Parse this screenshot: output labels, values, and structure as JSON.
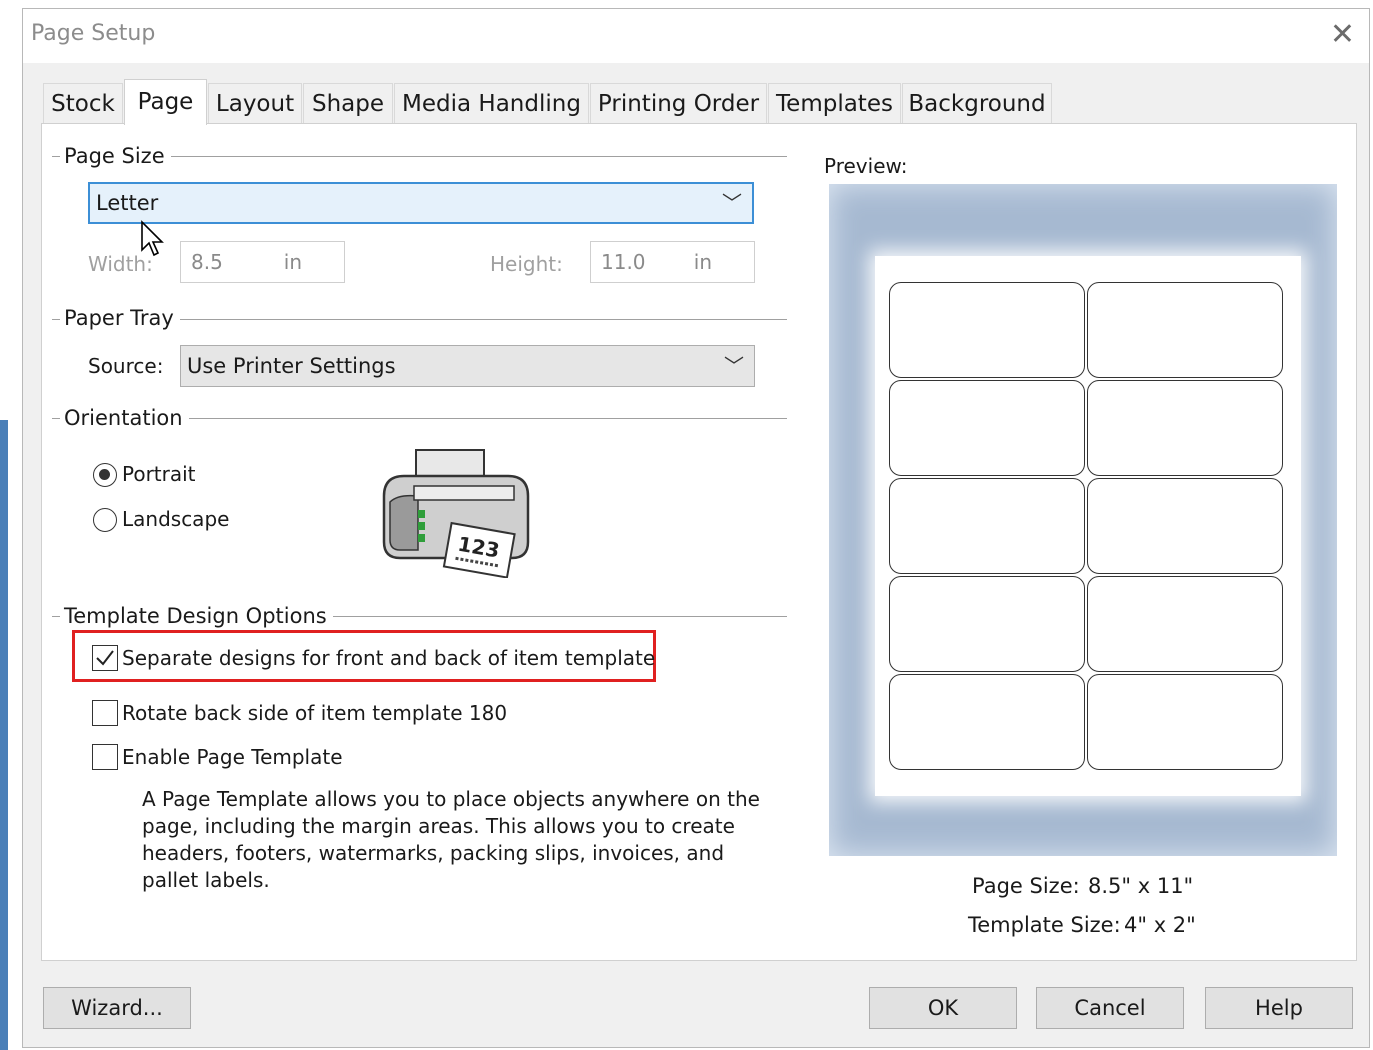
{
  "window": {
    "title": "Page Setup"
  },
  "tabs": [
    {
      "label": "Stock"
    },
    {
      "label": "Page"
    },
    {
      "label": "Layout"
    },
    {
      "label": "Shape"
    },
    {
      "label": "Media Handling"
    },
    {
      "label": "Printing Order"
    },
    {
      "label": "Templates"
    },
    {
      "label": "Background"
    }
  ],
  "active_tab": "Page",
  "page_size": {
    "group_label": "Page Size",
    "selected": "Letter",
    "width_label": "Width:",
    "width_value": "8.5",
    "width_unit": "in",
    "height_label": "Height:",
    "height_value": "11.0",
    "height_unit": "in"
  },
  "paper_tray": {
    "group_label": "Paper Tray",
    "source_label": "Source:",
    "source_value": "Use Printer Settings"
  },
  "orientation": {
    "group_label": "Orientation",
    "portrait_label": "Portrait",
    "landscape_label": "Landscape",
    "selected": "Portrait",
    "printer_page_text": "123"
  },
  "template_design": {
    "group_label": "Template Design Options",
    "separate_label": "Separate designs for front and back of item template",
    "separate_checked": true,
    "rotate_label": "Rotate back side of item template 180",
    "rotate_checked": false,
    "enable_label": "Enable Page Template",
    "enable_checked": false,
    "description": "A Page Template allows you to place objects anywhere on the page, including the margin areas. This allows you to create headers, footers, watermarks, packing slips, invoices, and pallet labels."
  },
  "preview": {
    "label": "Preview:",
    "page_size_label": "Page Size:",
    "page_size_value": "8.5\" x 11\"",
    "template_size_label": "Template Size:",
    "template_size_value": "4\" x 2\"",
    "label_rows": 5,
    "label_cols": 2
  },
  "buttons": {
    "wizard": "Wizard...",
    "ok": "OK",
    "cancel": "Cancel",
    "help": "Help"
  },
  "colors": {
    "highlight": "#e02020",
    "preview_bg": "#a6b9d1",
    "focus_border": "#3c8fd6"
  }
}
